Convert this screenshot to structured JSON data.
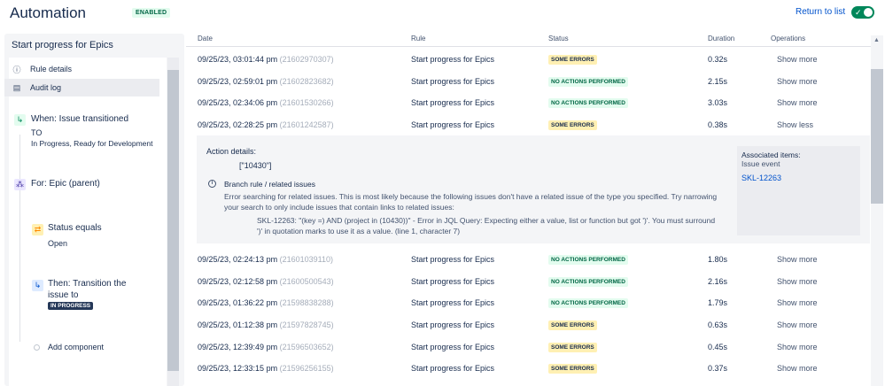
{
  "header": {
    "title": "Automation",
    "status_badge": "ENABLED",
    "return_link": "Return to list",
    "toggle_state": "on"
  },
  "sidebar": {
    "title": "Start progress for Epics",
    "nav": [
      {
        "label": "Rule details",
        "icon": "info-icon"
      },
      {
        "label": "Audit log",
        "icon": "clipboard-icon"
      }
    ],
    "steps": {
      "trigger_title": "When: Issue transitioned",
      "trigger_to": "TO",
      "trigger_states": "In Progress, Ready for Development",
      "branch_title": "For: Epic (parent)",
      "condition_title": "Status equals",
      "condition_value": "Open",
      "action_title_line1": "Then: Transition the",
      "action_title_line2": "issue to",
      "action_badge": "IN PROGRESS",
      "add_component": "Add component"
    }
  },
  "table": {
    "headers": {
      "date": "Date",
      "rule": "Rule",
      "status": "Status",
      "duration": "Duration",
      "operations": "Operations"
    },
    "rows": [
      {
        "date": "09/25/23, 03:01:44 pm",
        "id": "(21602970307)",
        "rule": "Start progress for Epics",
        "status": "SOME ERRORS",
        "status_type": "error",
        "duration": "0.32s",
        "op": "Show more"
      },
      {
        "date": "09/25/23, 02:59:01 pm",
        "id": "(21602823682)",
        "rule": "Start progress for Epics",
        "status": "NO ACTIONS PERFORMED",
        "status_type": "none",
        "duration": "2.15s",
        "op": "Show more"
      },
      {
        "date": "09/25/23, 02:34:06 pm",
        "id": "(21601530266)",
        "rule": "Start progress for Epics",
        "status": "NO ACTIONS PERFORMED",
        "status_type": "none",
        "duration": "3.03s",
        "op": "Show more"
      },
      {
        "date": "09/25/23, 02:28:25 pm",
        "id": "(21601242587)",
        "rule": "Start progress for Epics",
        "status": "SOME ERRORS",
        "status_type": "error",
        "duration": "0.38s",
        "op": "Show less"
      },
      {
        "date": "09/25/23, 02:24:13 pm",
        "id": "(21601039110)",
        "rule": "Start progress for Epics",
        "status": "NO ACTIONS PERFORMED",
        "status_type": "none",
        "duration": "1.80s",
        "op": "Show more"
      },
      {
        "date": "09/25/23, 02:12:58 pm",
        "id": "(21600500543)",
        "rule": "Start progress for Epics",
        "status": "NO ACTIONS PERFORMED",
        "status_type": "none",
        "duration": "2.16s",
        "op": "Show more"
      },
      {
        "date": "09/25/23, 01:36:22 pm",
        "id": "(21598838288)",
        "rule": "Start progress for Epics",
        "status": "NO ACTIONS PERFORMED",
        "status_type": "none",
        "duration": "1.79s",
        "op": "Show more"
      },
      {
        "date": "09/25/23, 01:12:38 pm",
        "id": "(21597828745)",
        "rule": "Start progress for Epics",
        "status": "SOME ERRORS",
        "status_type": "error",
        "duration": "0.63s",
        "op": "Show more"
      },
      {
        "date": "09/25/23, 12:39:49 pm",
        "id": "(21596503652)",
        "rule": "Start progress for Epics",
        "status": "SOME ERRORS",
        "status_type": "error",
        "duration": "0.45s",
        "op": "Show more"
      },
      {
        "date": "09/25/23, 12:33:15 pm",
        "id": "(21596256155)",
        "rule": "Start progress for Epics",
        "status": "SOME ERRORS",
        "status_type": "error",
        "duration": "0.37s",
        "op": "Show more"
      }
    ]
  },
  "details": {
    "title": "Action details:",
    "value": "[\"10430\"]",
    "branch_title": "Branch rule / related issues",
    "branch_body": "Error searching for related issues. This is most likely because the following issues don't have a related issue of the type you specified. Try narrowing your search to only include issues that contain links to related issues:",
    "branch_error": "SKL-12263: \"(key =) AND (project in (10430))\" - Error in JQL Query: Expecting either a value, list or function but got ')'. You must surround ')' in quotation marks to use it as a value. (line 1, character 7)",
    "assoc_title": "Associated items:",
    "assoc_sub": "Issue event",
    "assoc_link": "SKL-12263"
  },
  "colors": {
    "accent": "#0052cc",
    "success": "#00875a",
    "error_badge": "#fff0b3",
    "none_badge": "#e3fcef"
  }
}
